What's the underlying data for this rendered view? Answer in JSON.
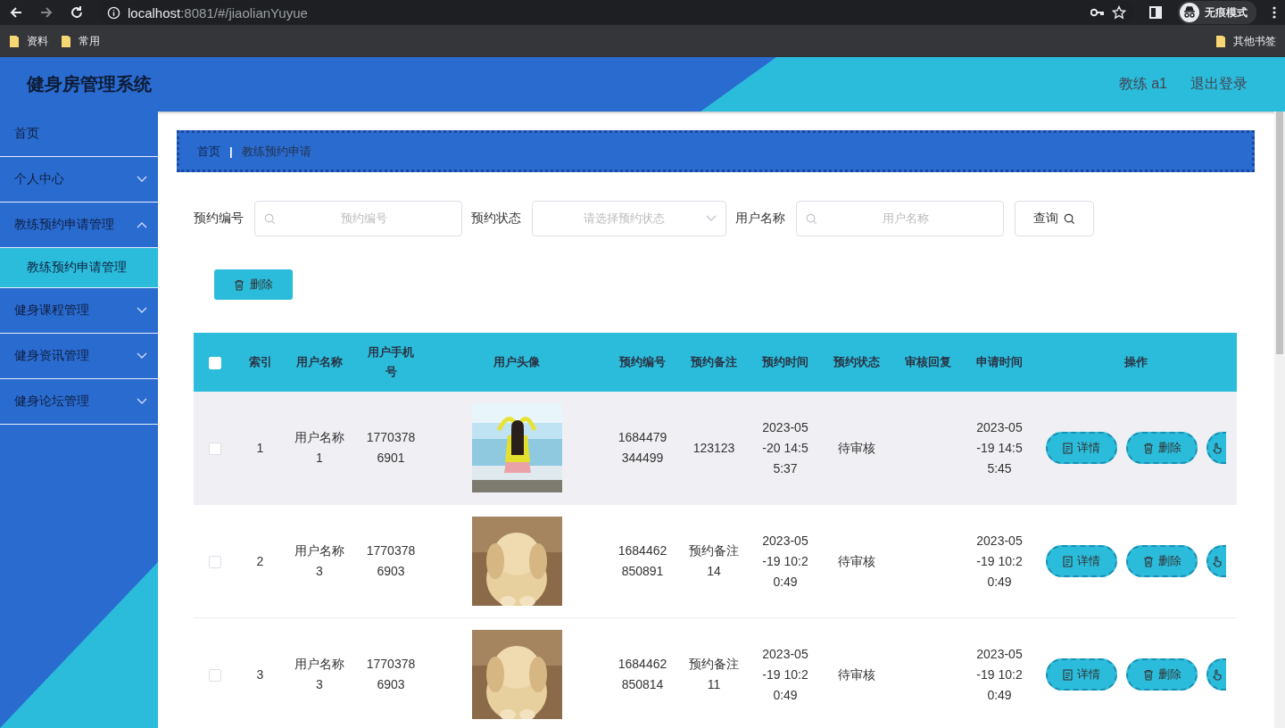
{
  "browser": {
    "url_host": "localhost",
    "url_rest": ":8081/#/jiaolianYuyue",
    "profile_label": "无痕模式",
    "bookmarks": [
      "资料",
      "常用"
    ],
    "other_bookmarks": "其他书签"
  },
  "header": {
    "title": "健身房管理系统",
    "user": "教练 a1",
    "logout": "退出登录"
  },
  "sidebar": {
    "items": [
      {
        "label": "首页",
        "kind": "link",
        "selected": false
      },
      {
        "label": "个人中心",
        "kind": "submenu",
        "expanded": false,
        "selected": false
      },
      {
        "label": "教练预约申请管理",
        "kind": "submenu",
        "expanded": true,
        "selected": false,
        "children": [
          {
            "label": "教练预约申请管理",
            "selected": true
          }
        ]
      },
      {
        "label": "健身课程管理",
        "kind": "submenu",
        "expanded": false,
        "selected": false
      },
      {
        "label": "健身资讯管理",
        "kind": "submenu",
        "expanded": false,
        "selected": false
      },
      {
        "label": "健身论坛管理",
        "kind": "submenu",
        "expanded": false,
        "selected": false
      }
    ]
  },
  "breadcrumb": [
    "首页",
    "|",
    "教练预约申请"
  ],
  "filters": [
    {
      "label": "预约编号",
      "kind": "search",
      "placeholder": "预约编号"
    },
    {
      "label": "预约状态",
      "kind": "select",
      "placeholder": "请选择预约状态"
    },
    {
      "label": "用户名称",
      "kind": "search",
      "placeholder": "用户名称"
    }
  ],
  "query_button": "查询",
  "delete_button": "删除",
  "table": {
    "all_checked": false,
    "columns": [
      "索引",
      "用户名称",
      "用户手机号",
      "用户头像",
      "预约编号",
      "预约备注",
      "预约时间",
      "预约状态",
      "审核回复",
      "申请时间",
      "操作"
    ],
    "rows": [
      {
        "highlighted": true,
        "checked": false,
        "index": "1",
        "user_name": "用户名称1",
        "phone": "17703786901",
        "booking_no": "1684479344499",
        "remark": "123123",
        "booking_time": "2023-05-20 14:55:37",
        "status": "待审核",
        "apply_time": "2023-05-19 14:55:45",
        "actions": [
          {
            "kind": "detail",
            "label": "详情"
          },
          {
            "kind": "delete",
            "label": "删除"
          },
          {
            "kind": "reply"
          }
        ]
      },
      {
        "highlighted": false,
        "checked": false,
        "index": "2",
        "user_name": "用户名称3",
        "phone": "17703786903",
        "booking_no": "1684462850891",
        "remark": "预约备注14",
        "booking_time": "2023-05-19 10:20:49",
        "status": "待审核",
        "apply_time": "2023-05-19 10:20:49",
        "actions": [
          {
            "kind": "detail",
            "label": "详情"
          },
          {
            "kind": "delete",
            "label": "删除"
          },
          {
            "kind": "reply"
          }
        ]
      },
      {
        "highlighted": false,
        "checked": false,
        "index": "3",
        "user_name": "用户名称3",
        "phone": "17703786903",
        "booking_no": "1684462850814",
        "remark": "预约备注11",
        "booking_time": "2023-05-19 10:20:49",
        "status": "待审核",
        "apply_time": "2023-05-19 10:20:49",
        "actions": [
          {
            "kind": "detail",
            "label": "详情"
          },
          {
            "kind": "delete",
            "label": "删除"
          },
          {
            "kind": "reply"
          }
        ]
      }
    ]
  }
}
